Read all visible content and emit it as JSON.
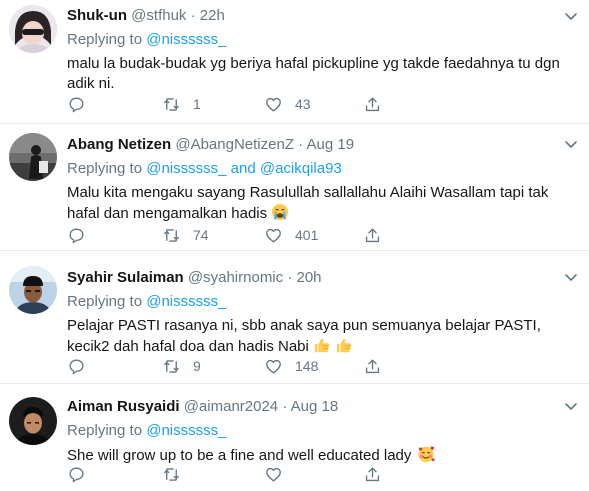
{
  "colors": {
    "accent": "#1da1f2",
    "muted": "#657786",
    "border": "#e6ecf0"
  },
  "tweets": [
    {
      "name": "Shuk-un",
      "handle": "@stfhuk",
      "dot": "·",
      "time": "22h",
      "replying_label": "Replying to",
      "mentions": [
        "@nissssss_"
      ],
      "mention_joiner": "",
      "text": "malu la budak-budak yg beriya hafal pickupline yg takde faedahnya tu dgn adik ni.",
      "emoji": "",
      "replies": "",
      "retweets": "1",
      "likes": "43"
    },
    {
      "name": "Abang Netizen",
      "handle": "@AbangNetizenZ",
      "dot": "·",
      "time": "Aug 19",
      "replying_label": "Replying to",
      "mentions": [
        "@nissssss_",
        "@acikqila93"
      ],
      "mention_joiner": "and",
      "text": "Malu kita mengaku sayang Rasulullah sallallahu Alaihi Wasallam tapi tak hafal dan mengamalkan hadis",
      "emoji": "crying-face-emoji",
      "replies": "",
      "retweets": "74",
      "likes": "401"
    },
    {
      "name": "Syahir Sulaiman",
      "handle": "@syahirnomic",
      "dot": "·",
      "time": "20h",
      "replying_label": "Replying to",
      "mentions": [
        "@nissssss_"
      ],
      "mention_joiner": "",
      "text": "Pelajar PASTI rasanya ni, sbb anak saya pun semuanya belajar PASTI, kecik2 dah hafal doa dan hadis Nabi",
      "emoji": "thumbs-up-emoji",
      "replies": "",
      "retweets": "9",
      "likes": "148"
    },
    {
      "name": "Aiman Rusyaidi",
      "handle": "@aimanr2024",
      "dot": "·",
      "time": "Aug 18",
      "replying_label": "Replying to",
      "mentions": [
        "@nissssss_"
      ],
      "mention_joiner": "",
      "text": "She will grow up to be a fine and well educated lady",
      "emoji": "smiling-face-with-hearts-emoji",
      "replies": "",
      "retweets": "",
      "likes": ""
    }
  ]
}
